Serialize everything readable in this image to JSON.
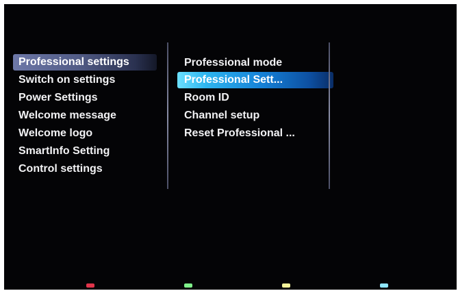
{
  "left_menu": {
    "items": [
      {
        "label": "Professional settings"
      },
      {
        "label": "Switch on settings"
      },
      {
        "label": "Power Settings"
      },
      {
        "label": "Welcome message"
      },
      {
        "label": "Welcome logo"
      },
      {
        "label": "SmartInfo Setting"
      },
      {
        "label": "Control settings"
      }
    ],
    "selected_index": 0
  },
  "sub_menu": {
    "items": [
      {
        "label": "Professional mode"
      },
      {
        "label": "Professional Sett..."
      },
      {
        "label": "Room ID"
      },
      {
        "label": "Channel setup"
      },
      {
        "label": "Reset Professional ..."
      }
    ],
    "focused_index": 1
  },
  "color_keys": [
    {
      "name": "red",
      "color": "#e0344a"
    },
    {
      "name": "green",
      "color": "#7ff08a"
    },
    {
      "name": "yellow",
      "color": "#f4f39a"
    },
    {
      "name": "blue",
      "color": "#8fe6ff"
    }
  ]
}
